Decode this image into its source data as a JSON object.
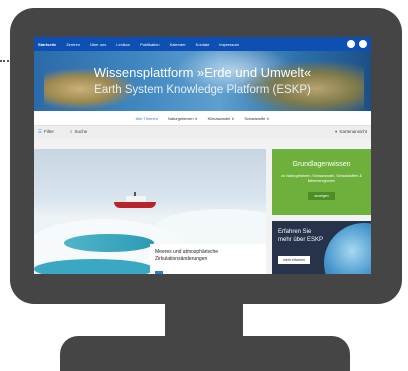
{
  "nav": {
    "items": [
      "Startseite",
      "Zentren",
      "Über uns",
      "Lexikon",
      "Publikation",
      "Kalender",
      "Kontakt",
      "Impressum"
    ],
    "accent": "#0d4fb3"
  },
  "hero": {
    "title": "Wissensplattform »Erde und Umwelt«",
    "subtitle": "Earth System Knowledge Platform (ESKP)"
  },
  "categories": [
    "Alle Themen",
    "Naturgefahren ∨",
    "Klimawandel ∨",
    "Schadstoffe ∨"
  ],
  "toolbar": {
    "filter_label": "Filter",
    "search_label": "Suche",
    "map_label": "Kartenansicht"
  },
  "feature": {
    "caption_line1": "Meeres und atmosphärische",
    "caption_line2": "Zirkulationsänderungen"
  },
  "green_tile": {
    "title": "Grundlagenwissen",
    "text": "zu Naturgefahren, Klimawandel, Schadstoffen & Meeresregionen",
    "button": "anzeigen",
    "color": "#6db13c"
  },
  "globe_tile": {
    "line1": "Erfahren Sie",
    "line2": "mehr über ESKP",
    "button": "mehr erfahren"
  }
}
